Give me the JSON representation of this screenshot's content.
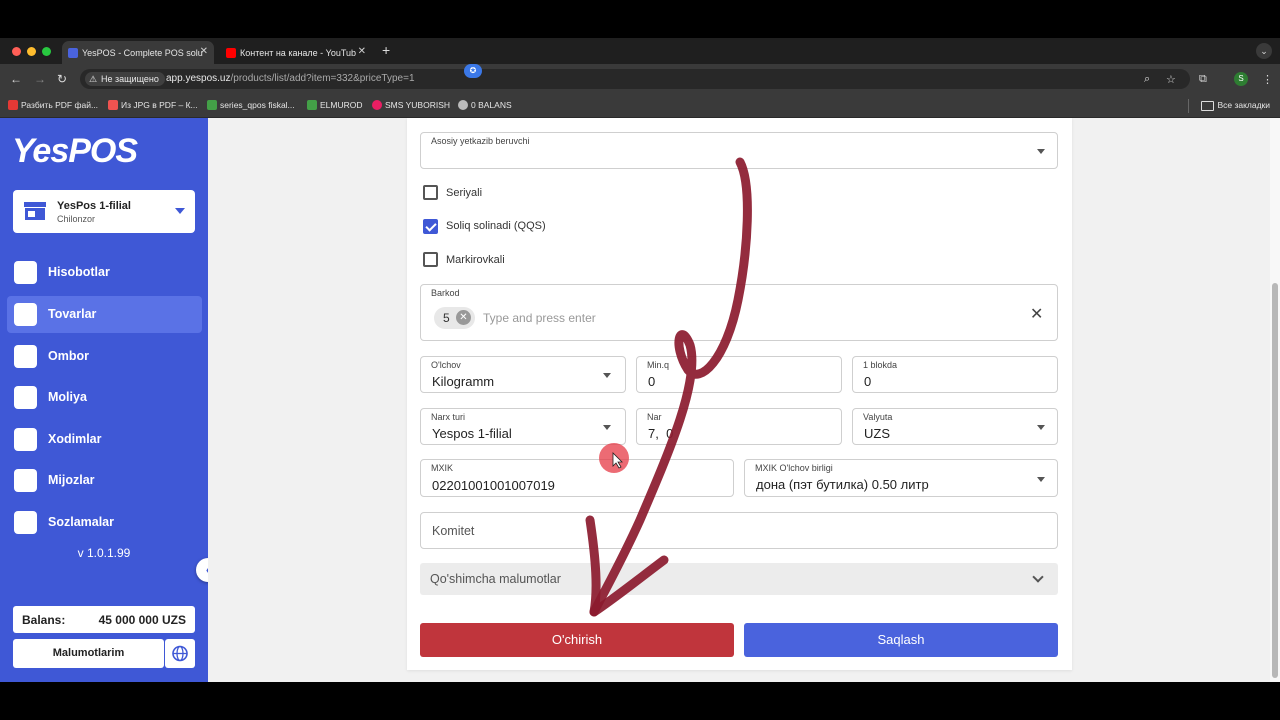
{
  "browser": {
    "tabs": [
      {
        "title": "YesPOS - Complete POS solu",
        "active": true
      },
      {
        "title": "Контент на канале - YouTub",
        "active": false
      }
    ],
    "security_label": "Не защищено",
    "url_host": "app.yespos.uz",
    "url_path": "/products/list/add?item=332&priceType=1",
    "profile_initial": "S",
    "bookmarks": [
      "Разбить PDF фай...",
      "Из JPG в PDF – К...",
      "series_qpos fiskal...",
      "ELMUROD",
      "SMS YUBORISH",
      "0 BALANS"
    ],
    "all_bookmarks": "Все закладки"
  },
  "sidebar": {
    "logo": "YesPOS",
    "branch_name": "YesPos 1-filial",
    "branch_location": "Chilonzor",
    "items": [
      {
        "label": "Hisobotlar",
        "icon": "chart-icon"
      },
      {
        "label": "Tovarlar",
        "icon": "basket-icon"
      },
      {
        "label": "Ombor",
        "icon": "box-icon"
      },
      {
        "label": "Moliya",
        "icon": "money-icon"
      },
      {
        "label": "Xodimlar",
        "icon": "team-icon"
      },
      {
        "label": "Mijozlar",
        "icon": "customers-icon"
      },
      {
        "label": "Sozlamalar",
        "icon": "gear-icon"
      }
    ],
    "active_item": "Tovarlar",
    "version": "v 1.0.1.99",
    "balance_label": "Balans:",
    "balance_value": "45 000 000 UZS",
    "my_info_label": "Malumotlarim"
  },
  "form": {
    "supplier_label": "Asosiy yetkazib beruvchi",
    "checkboxes": [
      {
        "label": "Seriyali",
        "checked": false
      },
      {
        "label": "Soliq solinadi (QQS)",
        "checked": true
      },
      {
        "label": "Markirovkali",
        "checked": false
      }
    ],
    "barcode_label": "Barkod",
    "barcode_chip": "5",
    "barcode_placeholder": "Type and press enter",
    "unit_label": "O'lchov",
    "unit_value": "Kilogramm",
    "min_label": "Min.q",
    "min_value": "0",
    "block_label": "1 blokda",
    "block_value": "0",
    "price_type_label": "Narx turi",
    "price_type_value": "Yespos 1-filial",
    "price_label": "Nar",
    "price_value": "7,  0",
    "currency_label": "Valyuta",
    "currency_value": "UZS",
    "mxik_label": "MXIK",
    "mxik_value": "02201001001007019",
    "mxik_unit_label": "MXIK O'lchov birligi",
    "mxik_unit_value": "дона (пэт бутилка) 0.50 литр",
    "committee_placeholder": "Komitet",
    "extra_info_label": "Qo'shimcha malumotlar",
    "delete_label": "O'chirish",
    "save_label": "Saqlash"
  },
  "colors": {
    "sidebar": "#3f58d6",
    "delete": "#c0353c",
    "save": "#4a63dd",
    "annotation": "#8b1a2e"
  }
}
